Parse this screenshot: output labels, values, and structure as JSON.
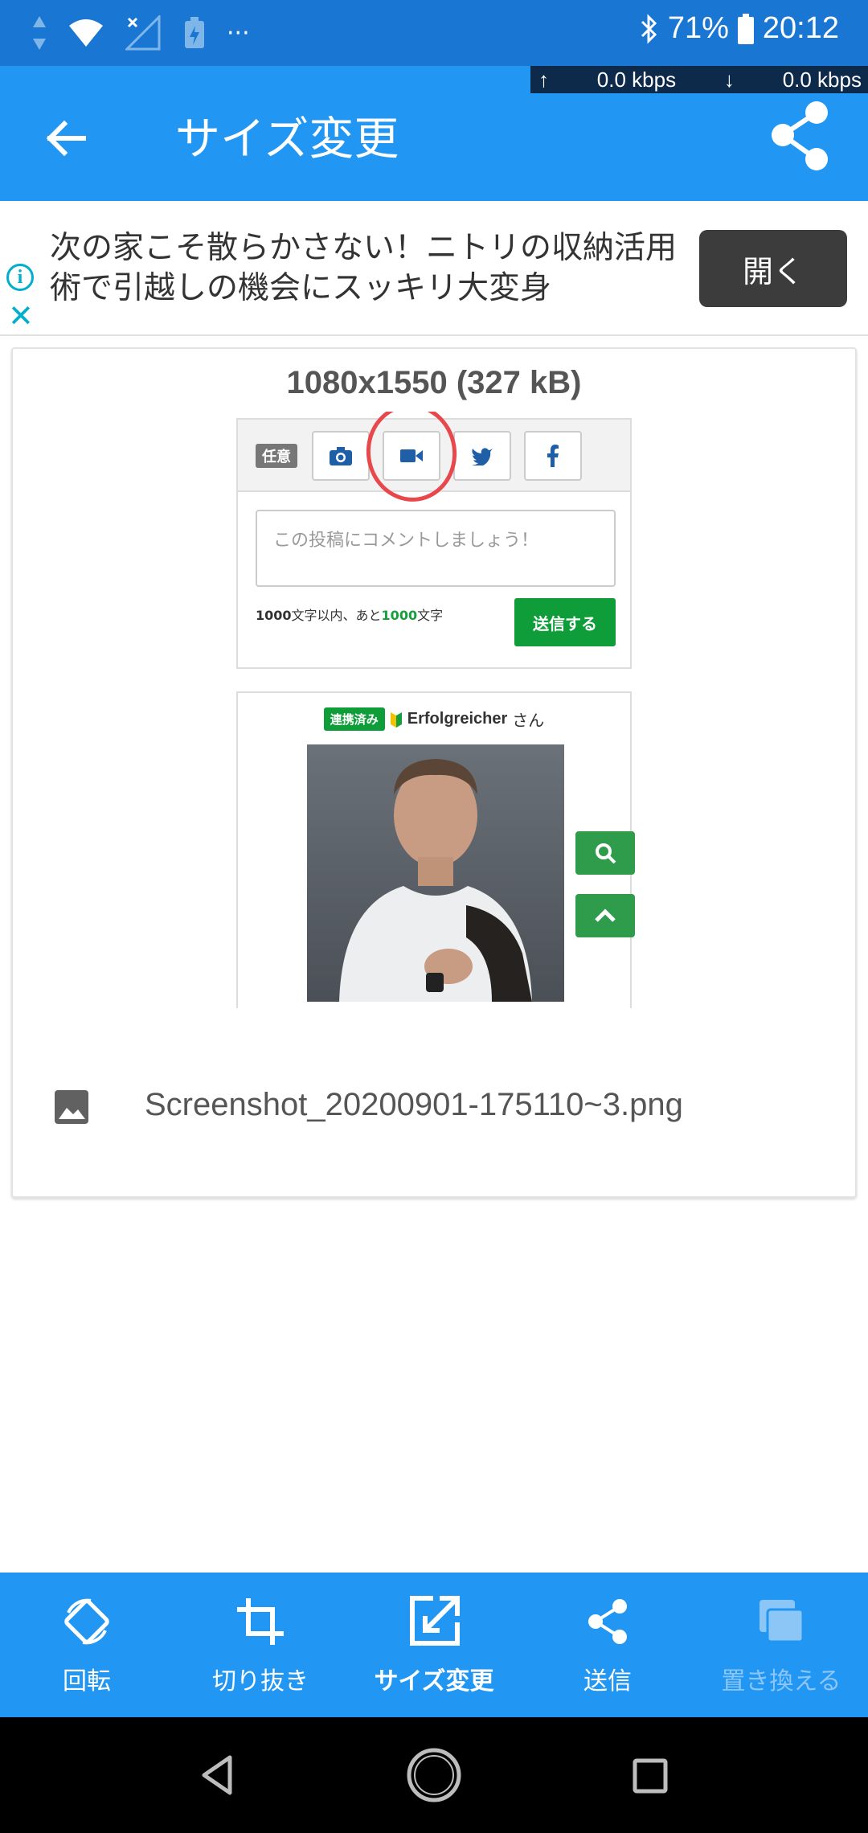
{
  "status_bar": {
    "battery": "71%",
    "time": "20:12",
    "upload_speed": "0.0 kbps",
    "download_speed": "0.0 kbps",
    "more": "···"
  },
  "app_bar": {
    "title": "サイズ変更",
    "back_icon": "arrow-back-icon",
    "share_icon": "share-icon"
  },
  "ad": {
    "text": "次の家こそ散らかさない！ニトリの収納活用術で引越しの機会にスッキリ大変身",
    "button_label": "開く",
    "info": "i",
    "close": "✕"
  },
  "image_info": {
    "dimensions": "1080x1550 (327 kB)",
    "filename": "Screenshot_20200901-175110~3.png"
  },
  "preview": {
    "tag": "任意",
    "comment_placeholder": "この投稿にコメントしましょう！",
    "count_prefix": "1000",
    "count_mid": "文字以内、あと",
    "count_remaining": "1000",
    "count_suffix": "文字",
    "send_label": "送信する",
    "linked_label": "連携済み",
    "user_name": "Erfolgreicher",
    "user_suffix": "さん"
  },
  "bottom_bar": {
    "items": [
      {
        "label": "回転",
        "icon": "rotate-icon",
        "state": "normal"
      },
      {
        "label": "切り抜き",
        "icon": "crop-icon",
        "state": "normal"
      },
      {
        "label": "サイズ変更",
        "icon": "resize-icon",
        "state": "active"
      },
      {
        "label": "送信",
        "icon": "send-share-icon",
        "state": "normal"
      },
      {
        "label": "置き換える",
        "icon": "replace-icon",
        "state": "disabled"
      }
    ]
  },
  "colors": {
    "status_bar": "#1976d2",
    "app_bar": "#2196f3",
    "accent_green": "#0f9d3a",
    "ad_button": "#3c3c3c"
  }
}
